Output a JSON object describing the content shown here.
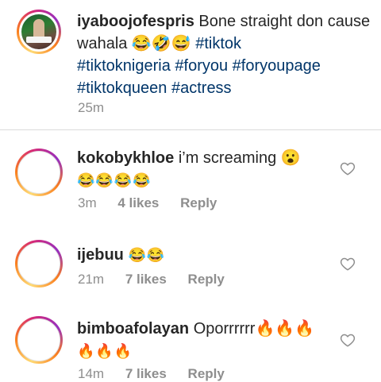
{
  "caption": {
    "username": "iyaboojofespris",
    "text": "Bone straight don cause wahala 😂🤣😅",
    "hashtags_line1": "#tiktok",
    "hashtags_line2": "#tiktoknigeria #foryou #foryoupage",
    "hashtags_line3": "#tiktokqueen #actress",
    "time": "25m"
  },
  "comments": [
    {
      "username": "kokobykhloe",
      "text": "i’m screaming 😮",
      "text_line2": "😂😂😂😂",
      "time": "3m",
      "likes": "4 likes",
      "reply": "Reply"
    },
    {
      "username": "ijebuu",
      "text": "😂😂",
      "time": "21m",
      "likes": "7 likes",
      "reply": "Reply"
    },
    {
      "username": "bimboafolayan",
      "text": "Oporrrrrr🔥🔥🔥",
      "text_line2": "🔥🔥🔥",
      "time": "14m",
      "likes": "7 likes",
      "reply": "Reply"
    }
  ],
  "icons": {
    "like": "heart-outline-icon"
  },
  "colors": {
    "hashtag": "#003569",
    "meta": "#8e8e8e",
    "text": "#262626"
  }
}
